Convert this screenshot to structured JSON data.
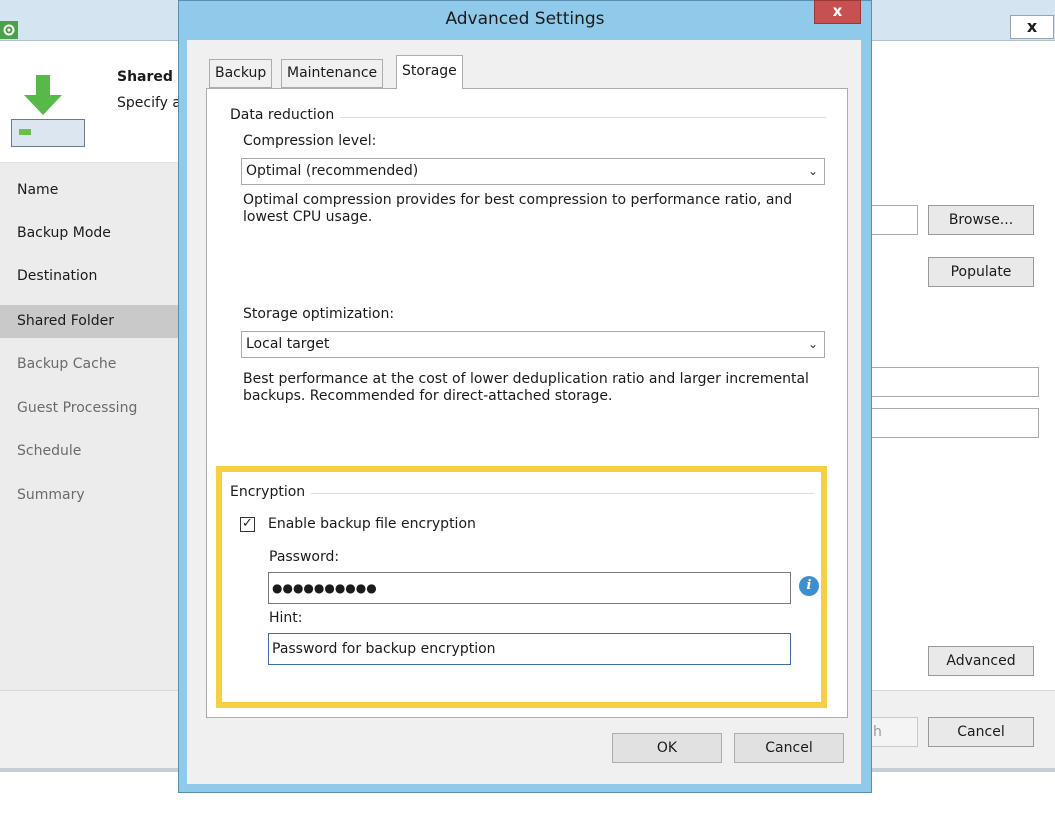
{
  "background_window": {
    "header": {
      "title": "Shared F",
      "description": "Specify a"
    },
    "nav": [
      {
        "label": "Name",
        "state": "inactive-dark"
      },
      {
        "label": "Backup Mode",
        "state": "inactive-dark"
      },
      {
        "label": "Destination",
        "state": "inactive-dark"
      },
      {
        "label": "Shared Folder",
        "state": "active"
      },
      {
        "label": "Backup Cache",
        "state": "inactive"
      },
      {
        "label": "Guest Processing",
        "state": "inactive"
      },
      {
        "label": "Schedule",
        "state": "inactive"
      },
      {
        "label": "Summary",
        "state": "inactive"
      }
    ],
    "buttons": {
      "browse": "Browse...",
      "populate": "Populate",
      "advanced": "Advanced",
      "finish_partial": "h",
      "cancel": "Cancel"
    },
    "close_glyph": "x"
  },
  "dialog": {
    "title": "Advanced Settings",
    "close_glyph": "x",
    "tabs": [
      {
        "label": "Backup",
        "selected": false
      },
      {
        "label": "Maintenance",
        "selected": false
      },
      {
        "label": "Storage",
        "selected": true
      }
    ],
    "data_reduction": {
      "group_label": "Data reduction",
      "compression_label": "Compression level:",
      "compression_value": "Optimal (recommended)",
      "compression_desc": "Optimal compression provides for best compression to performance ratio, and lowest CPU usage.",
      "storage_label": "Storage optimization:",
      "storage_value": "Local target",
      "storage_desc": "Best performance at the cost of lower deduplication ratio and larger incremental backups. Recommended for direct-attached storage."
    },
    "encryption": {
      "group_label": "Encryption",
      "enable_label": "Enable backup file encryption",
      "enabled": true,
      "password_label": "Password:",
      "password_value": "●●●●●●●●●●",
      "hint_label": "Hint:",
      "hint_value": "Password for backup encryption"
    },
    "buttons": {
      "ok": "OK",
      "cancel": "Cancel"
    },
    "highlight_color": "#f6cf43"
  }
}
